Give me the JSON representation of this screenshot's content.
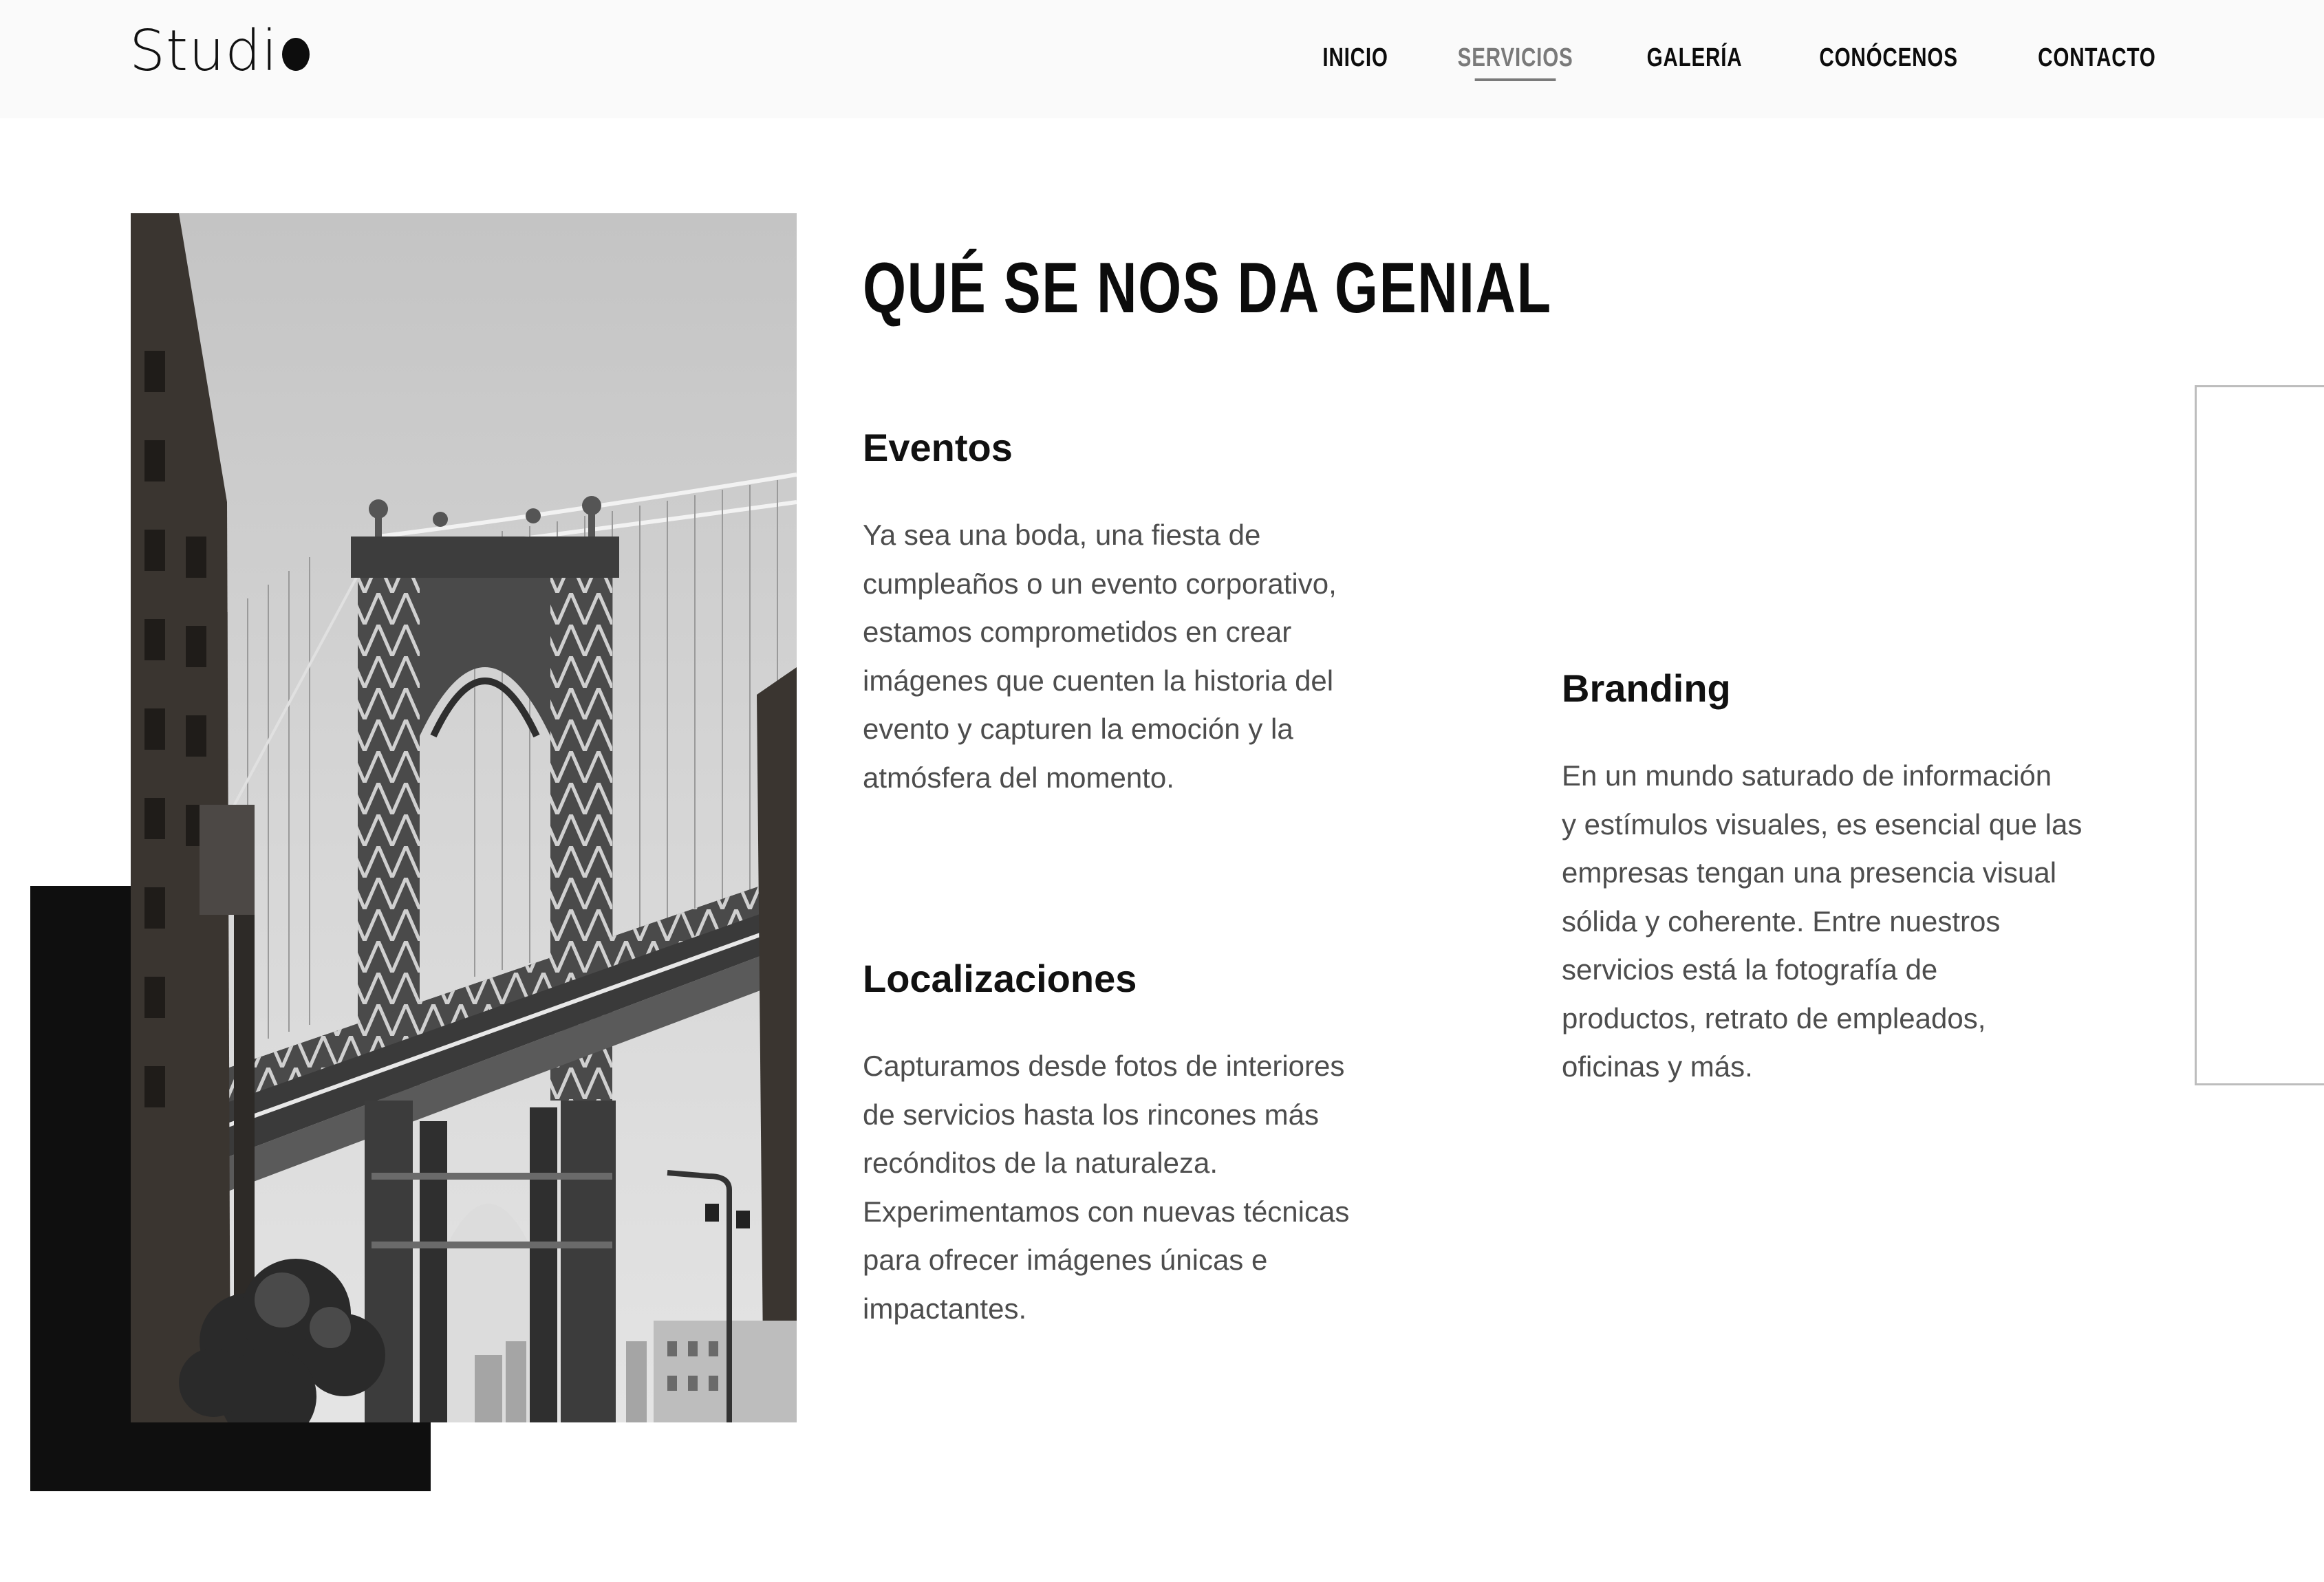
{
  "header": {
    "logo_text": "Studi",
    "nav": [
      "INICIO",
      "SERVICIOS",
      "GALERÍA",
      "CONÓCENOS",
      "CONTACTO"
    ],
    "active_nav": "SERVICIOS"
  },
  "main": {
    "title": "QUÉ SE NOS DA GENIAL",
    "services": [
      {
        "title": "Eventos",
        "lines": [
          "Ya sea una boda, una fiesta de",
          "cumpleaños o un evento corporativo,",
          "estamos comprometidos en crear",
          "imágenes que cuenten la historia del",
          "evento y capturen la emoción y la",
          "atmósfera del momento."
        ]
      },
      {
        "title": "Localizaciones",
        "lines": [
          "Capturamos desde fotos de interiores",
          "de servicios hasta los rincones más",
          "recónditos de la naturaleza.",
          "Experimentamos con nuevas técnicas",
          "para ofrecer imágenes únicas e",
          "impactantes."
        ]
      },
      {
        "title": "Branding",
        "lines": [
          "En un mundo saturado de información",
          "y estímulos visuales, es esencial que las",
          "empresas tengan una presencia visual",
          "sólida y coherente. Entre nuestros",
          "servicios está la fotografía de",
          "productos, retrato de empleados,",
          "oficinas y más."
        ]
      }
    ]
  },
  "image": {
    "subject": "bridge-photo"
  },
  "colors": {
    "text": "#0c0c0c",
    "body_text": "#4d4d4d",
    "active_nav": "#7a7a7a",
    "header_bg": "#fafafa",
    "block": "#0f0f0f"
  }
}
